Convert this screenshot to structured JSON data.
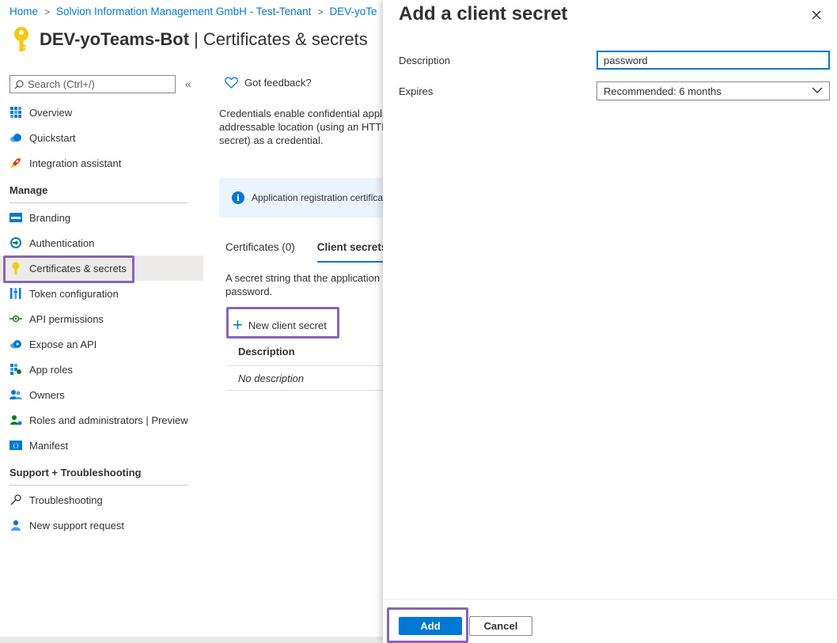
{
  "breadcrumb": {
    "items": [
      "Home",
      "Solvion Information Management GmbH - Test-Tenant",
      "DEV-yoTe"
    ]
  },
  "header": {
    "app_name": "DEV-yoTeams-Bot",
    "page_name": "| Certificates & secrets",
    "icon": "key-icon"
  },
  "sidebar": {
    "search_placeholder": "Search (Ctrl+/)",
    "collapse_label": "«",
    "items_top": [
      {
        "label": "Overview",
        "icon": "grid-icon"
      },
      {
        "label": "Quickstart",
        "icon": "cloud-icon"
      },
      {
        "label": "Integration assistant",
        "icon": "rocket-icon"
      }
    ],
    "manage_heading": "Manage",
    "items_manage": [
      {
        "label": "Branding",
        "icon": "branding-icon"
      },
      {
        "label": "Authentication",
        "icon": "authentication-icon"
      },
      {
        "label": "Certificates & secrets",
        "icon": "key-icon",
        "active": true
      },
      {
        "label": "Token configuration",
        "icon": "token-bars-icon"
      },
      {
        "label": "API permissions",
        "icon": "api-permissions-icon"
      },
      {
        "label": "Expose an API",
        "icon": "cloud-api-icon"
      },
      {
        "label": "App roles",
        "icon": "app-roles-icon"
      },
      {
        "label": "Owners",
        "icon": "people-icon"
      },
      {
        "label": "Roles and administrators | Preview",
        "icon": "admin-icon"
      },
      {
        "label": "Manifest",
        "icon": "manifest-icon"
      }
    ],
    "support_heading": "Support + Troubleshooting",
    "items_support": [
      {
        "label": "Troubleshooting",
        "icon": "wrench-icon"
      },
      {
        "label": "New support request",
        "icon": "support-person-icon"
      }
    ]
  },
  "main": {
    "feedback_label": "Got feedback?",
    "description": "Credentials enable confidential appli\naddressable location (using an HTTP\nsecret) as a credential.",
    "info_text": "Application registration certifica",
    "tabs": [
      {
        "label": "Certificates (0)"
      },
      {
        "label": "Client secrets",
        "active": true
      }
    ],
    "secret_description": "A secret string that the application\npassword.",
    "new_secret_label": "New client secret",
    "table": {
      "column_header": "Description",
      "empty_row": "No description"
    }
  },
  "panel": {
    "title": "Add a client secret",
    "description_label": "Description",
    "description_value": "password",
    "expires_label": "Expires",
    "expires_value": "Recommended: 6 months",
    "add_label": "Add",
    "cancel_label": "Cancel"
  },
  "colors": {
    "accent": "#0078d4",
    "highlight": "#8764b8",
    "key_gold": "#f2c811"
  }
}
